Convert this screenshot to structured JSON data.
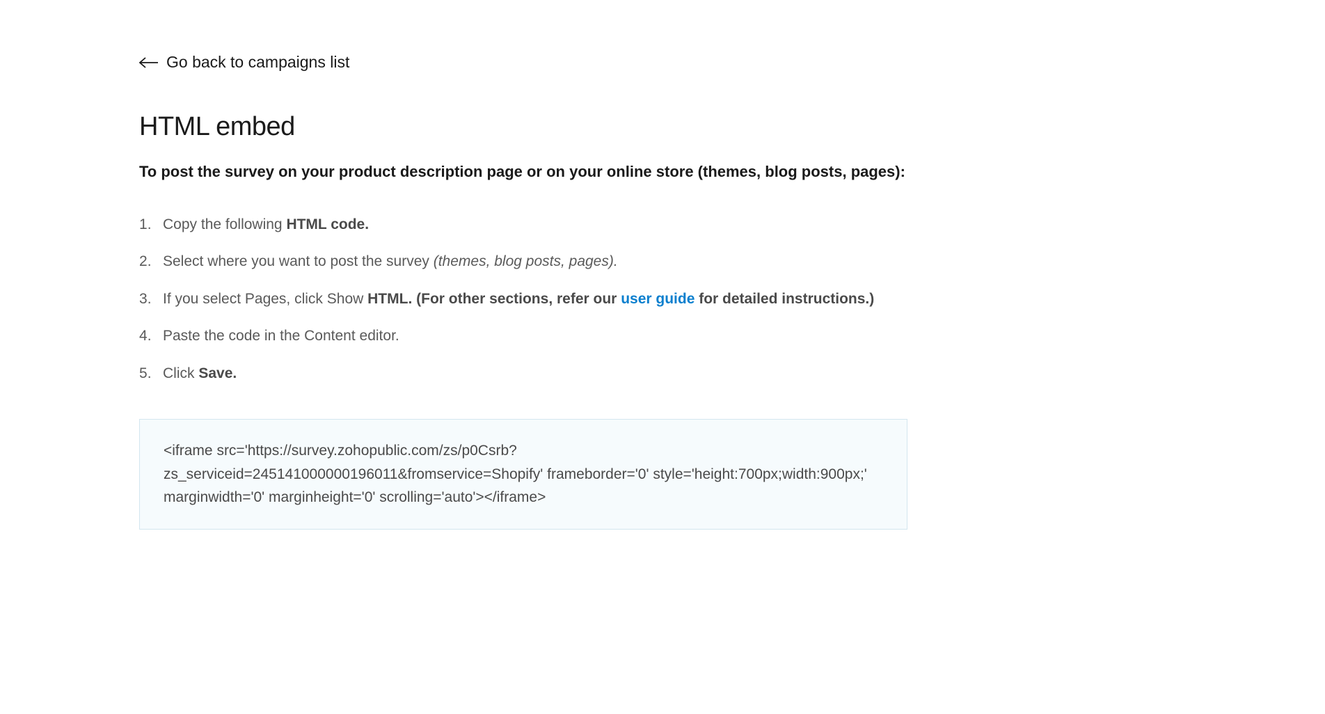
{
  "backLink": {
    "label": "Go back to campaigns list"
  },
  "title": "HTML embed",
  "subtitle": "To post the survey on your product description page or on your online store (themes, blog posts, pages):",
  "steps": {
    "s1_prefix": "Copy the following ",
    "s1_bold": "HTML code.",
    "s2_prefix": "Select where you want to post the survey ",
    "s2_italic": "(themes, blog posts, pages).",
    "s3_prefix": "If you select Pages, click Show ",
    "s3_bold1": "HTML. (For other sections, refer our ",
    "s3_link": "user guide",
    "s3_bold2": " for detailed instructions.)",
    "s4": "Paste the code in the Content editor.",
    "s5_prefix": "Click ",
    "s5_bold": "Save."
  },
  "codeSnippet": "<iframe src='https://survey.zohopublic.com/zs/p0Csrb?zs_serviceid=245141000000196011&fromservice=Shopify' frameborder='0' style='height:700px;width:900px;' marginwidth='0' marginheight='0' scrolling='auto'></iframe>"
}
